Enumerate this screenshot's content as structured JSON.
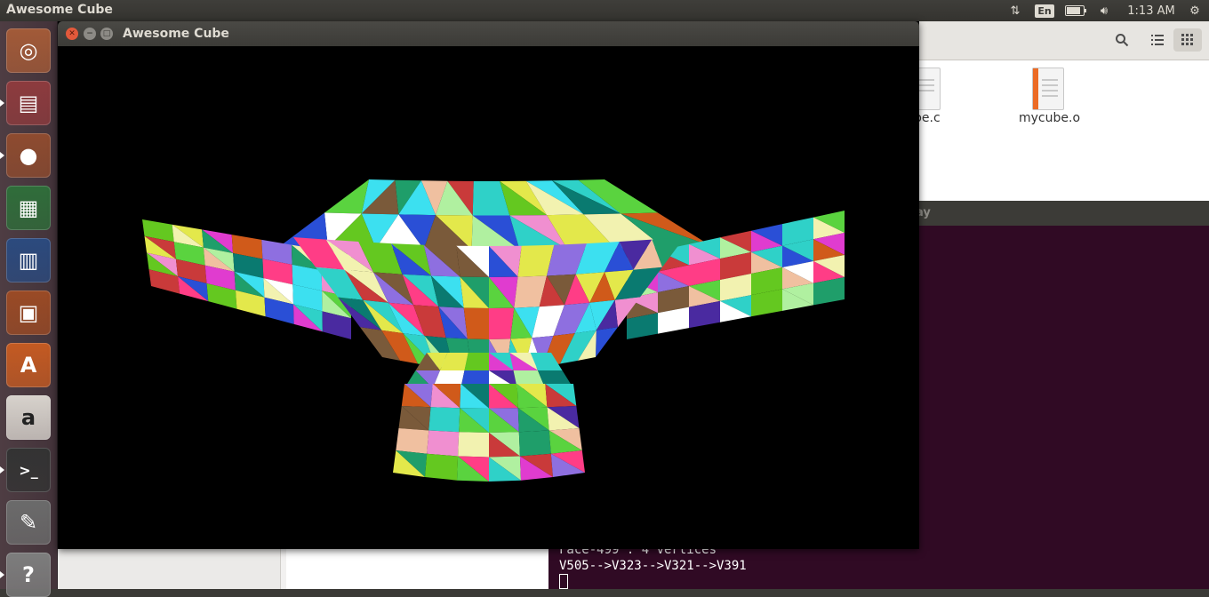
{
  "top_panel": {
    "app_title": "Awesome Cube",
    "language": "En",
    "battery_level": 0.85,
    "clock": "1:13 AM"
  },
  "launcher": {
    "items": [
      {
        "name": "dash-home",
        "icon": "ubuntu-logo-icon",
        "color": "#a25a38",
        "running": false
      },
      {
        "name": "files",
        "icon": "file-cabinet-icon",
        "color": "#8d3b3e",
        "running": true
      },
      {
        "name": "firefox",
        "icon": "firefox-icon",
        "color": "#8e4b2f",
        "running": true
      },
      {
        "name": "libreoffice-calc",
        "icon": "spreadsheet-icon",
        "color": "#2f6d3a",
        "running": false
      },
      {
        "name": "libreoffice-writer",
        "icon": "document-icon",
        "color": "#2b4a7e",
        "running": false
      },
      {
        "name": "libreoffice-impress",
        "icon": "presentation-icon",
        "color": "#9a4a25",
        "running": false
      },
      {
        "name": "ubuntu-software",
        "icon": "shopping-bag-icon",
        "color": "#c45a22",
        "running": false
      },
      {
        "name": "amazon",
        "icon": "amazon-icon",
        "color": "#d7d2cc",
        "running": false
      },
      {
        "name": "terminal",
        "icon": "terminal-icon",
        "color": "#333333",
        "running": true
      },
      {
        "name": "system-settings",
        "icon": "wrench-gear-icon",
        "color": "#6b6b6b",
        "running": false
      },
      {
        "name": "help",
        "icon": "question-mark-icon",
        "color": "#7d7d7d",
        "running": true
      }
    ]
  },
  "file_manager": {
    "files": [
      {
        "label": "be.c"
      },
      {
        "label": "mycube.o"
      }
    ]
  },
  "terminal": {
    "title_fragment": "ay",
    "lines": [
      "Face-499 : 4 vertices",
      "V505-->V323-->V321-->V391"
    ]
  },
  "gl_window": {
    "title": "Awesome Cube"
  }
}
